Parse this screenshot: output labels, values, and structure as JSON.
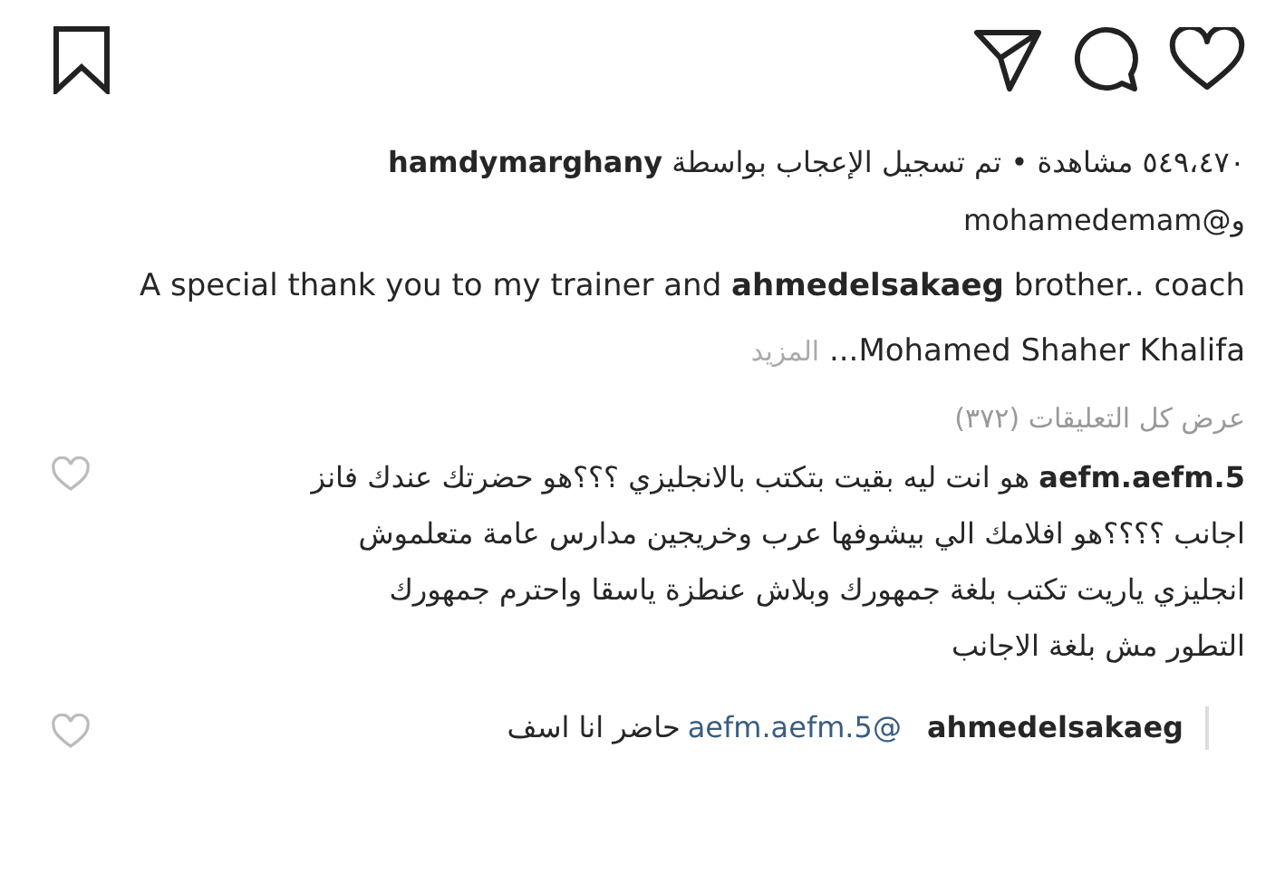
{
  "likes_line": {
    "prefix": "٥٤٩،٤٧٠ مشاهدة • تم تسجيل الإعجاب بواسطة",
    "user": "hamdymarghany",
    "continuation": "و@mohamedemam"
  },
  "caption": {
    "text": "A special thank you to my trainer and **ahmedelsakaeg** brother.. coach Mohamed Shaher Khalifa...",
    "more": "المزيد"
  },
  "view_all_comments": "عرض كل التعليقات (٣٧٢)",
  "comments": [
    {
      "user": "aefm.aefm.5",
      "text": "هو انت ليه بقيت بتكتب بالانجليزي ؟؟؟هو حضرتك عندك فانز اجانب ؟؟؟؟هو افلامك الي بيشوفها عرب وخريجين مدارس عامة متعلموش انجليزي ياريت تكتب بلغة جمهورك وبلاش عنطزة ياسقا واحترم جمهورك التطور مش بلغة الاجانب",
      "replies": [
        {
          "user": "ahmedelsakaeg",
          "mention": "@aefm.aefm.5",
          "text": "حاضر انا اسف"
        }
      ]
    }
  ]
}
